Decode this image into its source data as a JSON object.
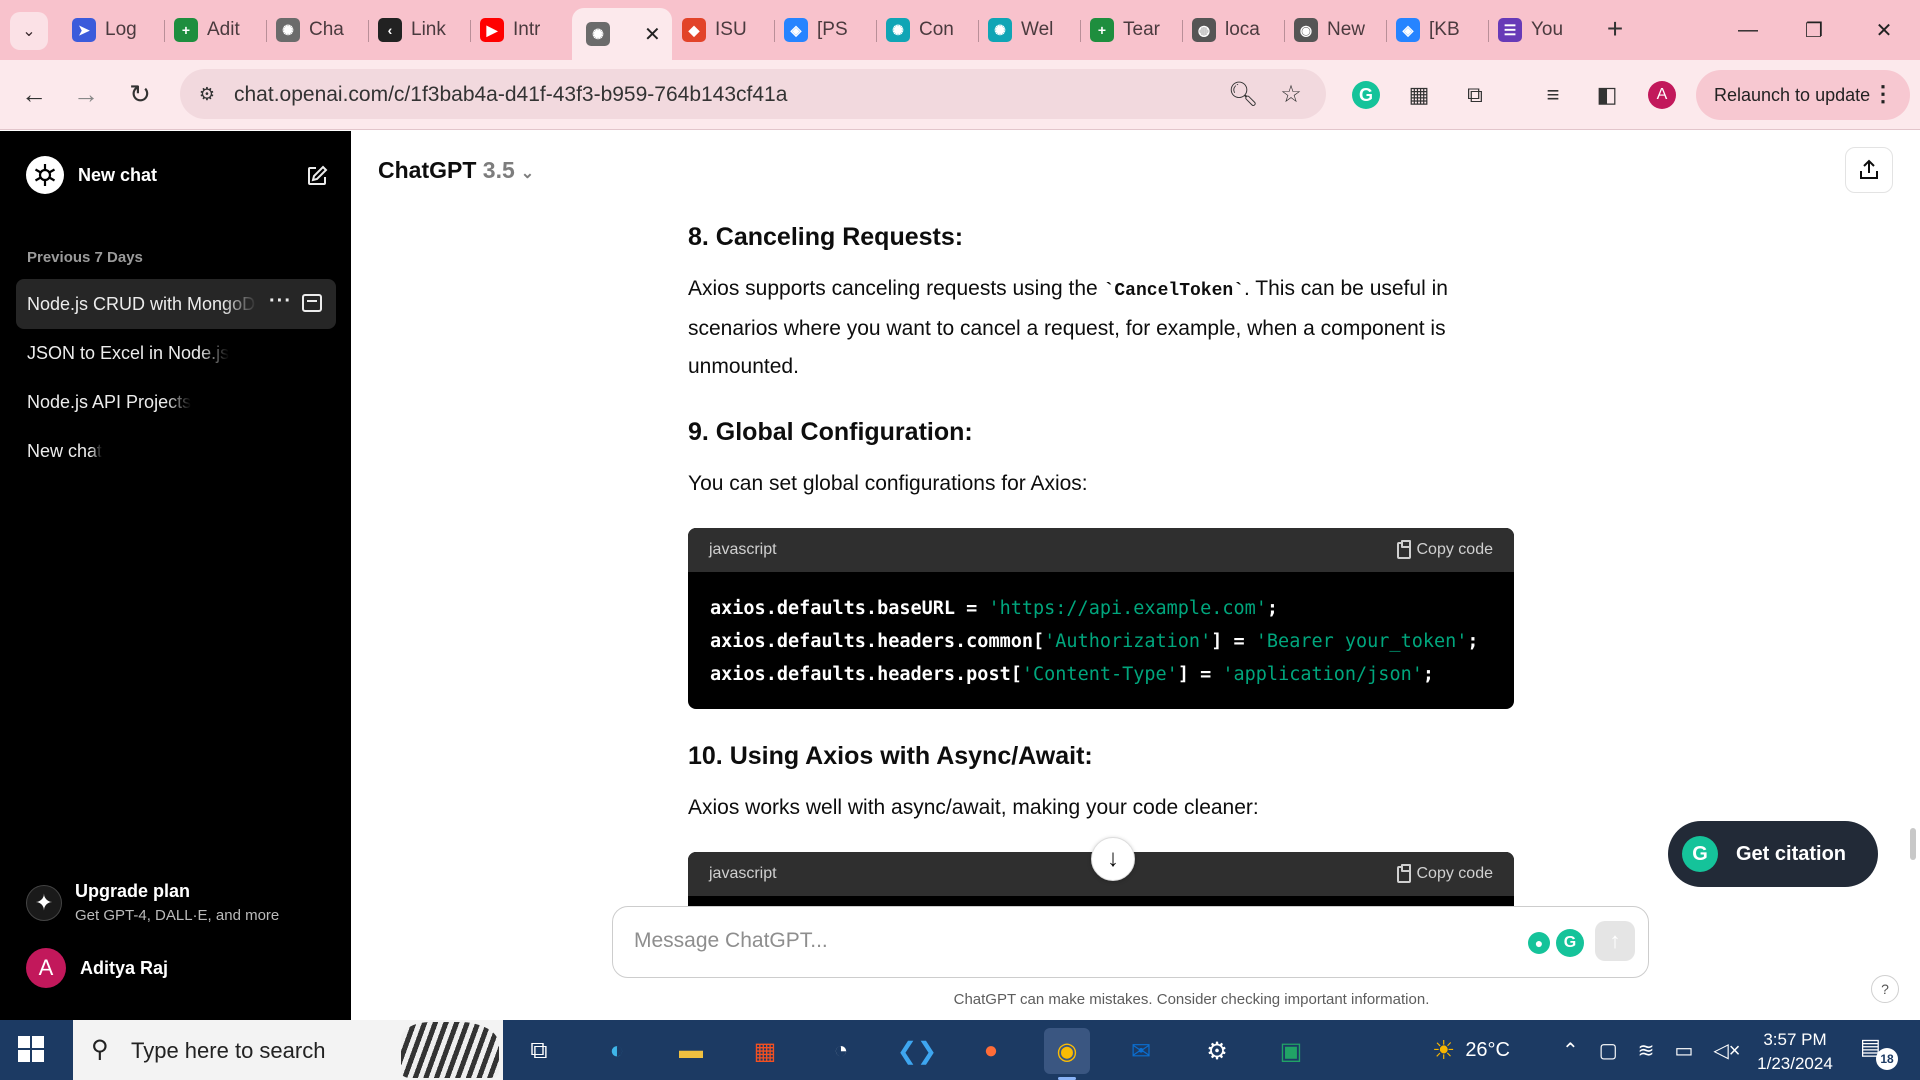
{
  "browser": {
    "tabs": [
      {
        "title": "Log",
        "icon": "arrow-logo-icon",
        "color": "#3b5bdb"
      },
      {
        "title": "Adit",
        "icon": "sheets-plus-icon",
        "color": "#1e8e3e"
      },
      {
        "title": "Cha",
        "icon": "chatgpt-icon",
        "color": "#6b6b6b"
      },
      {
        "title": "Link",
        "icon": "link-chevron-icon",
        "color": "#222"
      },
      {
        "title": "Intr",
        "icon": "youtube-icon",
        "color": "#ff0000"
      },
      {
        "title": "",
        "icon": "chatgpt-icon",
        "color": "#6b6b6b"
      },
      {
        "title": "ISU",
        "icon": "gitlab-icon",
        "color": "#e24329"
      },
      {
        "title": "[PS",
        "icon": "jira-icon",
        "color": "#2684ff"
      },
      {
        "title": "Con",
        "icon": "chatgpt-teal-icon",
        "color": "#10a5b5"
      },
      {
        "title": "Wel",
        "icon": "chatgpt-teal-icon",
        "color": "#10a5b5"
      },
      {
        "title": "Tear",
        "icon": "sheets-plus-icon",
        "color": "#1e8e3e"
      },
      {
        "title": "loca",
        "icon": "globe-icon",
        "color": "#555"
      },
      {
        "title": "New",
        "icon": "chrome-icon",
        "color": "#555"
      },
      {
        "title": "[KB",
        "icon": "jira-icon",
        "color": "#2684ff"
      },
      {
        "title": "You",
        "icon": "forms-icon",
        "color": "#673ab7"
      }
    ],
    "url": "chat.openai.com/c/1f3bab4a-d41f-43f3-b959-764b143cf41a",
    "relaunch_label": "Relaunch to update",
    "profile_initial": "A"
  },
  "sidebar": {
    "new_chat": "New chat",
    "section": "Previous 7 Days",
    "items": [
      {
        "label": "Node.js CRUD with MongoDB"
      },
      {
        "label": "JSON to Excel in Node.js"
      },
      {
        "label": "Node.js API Projects"
      },
      {
        "label": "New chat"
      }
    ],
    "upgrade_title": "Upgrade plan",
    "upgrade_sub": "Get GPT-4, DALL·E, and more",
    "user_initial": "A",
    "user_name": "Aditya Raj"
  },
  "header": {
    "model": "ChatGPT",
    "version": "3.5"
  },
  "content": {
    "h8": "8. Canceling Requests:",
    "p8_pre": "Axios supports canceling requests using the ",
    "p8_code": "`CancelToken`",
    "p8_post": ". This can be useful in scenarios where you want to cancel a request, for example, when a component is unmounted.",
    "h9": "9. Global Configuration:",
    "p9": "You can set global configurations for Axios:",
    "code1": {
      "lang": "javascript",
      "copy": "Copy code",
      "lines": [
        {
          "plain1": "axios.defaults.baseURL = ",
          "str1": "'https://api.example.com'",
          "plain2": ";",
          "str2": "",
          "plain3": ""
        },
        {
          "plain1": "axios.defaults.headers.common[",
          "str1": "'Authorization'",
          "plain2": "] = ",
          "str2": "'Bearer your_token'",
          "plain3": ";"
        },
        {
          "plain1": "axios.defaults.headers.post[",
          "str1": "'Content-Type'",
          "plain2": "] = ",
          "str2": "'application/json'",
          "plain3": ";"
        }
      ]
    },
    "h10": "10. Using Axios with Async/Await:",
    "p10": "Axios works well with async/await, making your code cleaner:",
    "code2": {
      "lang": "javascript",
      "copy": "Copy code"
    }
  },
  "composer": {
    "placeholder": "Message ChatGPT...",
    "disclaimer": "ChatGPT can make mistakes. Consider checking important information."
  },
  "citation_label": "Get citation",
  "taskbar": {
    "search_placeholder": "Type here to search",
    "weather": "26°C",
    "time": "3:57 PM",
    "date": "1/23/2024",
    "notifications": "18"
  }
}
